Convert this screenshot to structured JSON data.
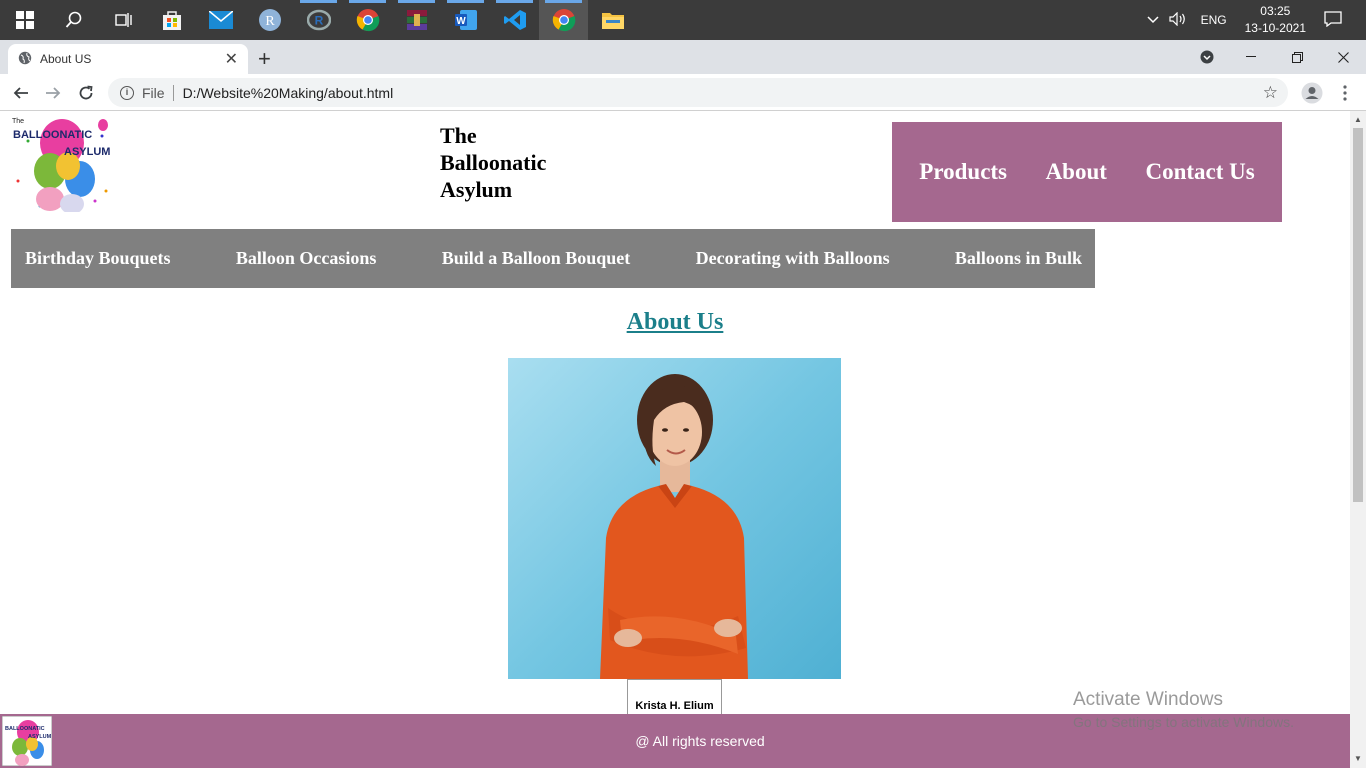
{
  "taskbar": {
    "apps": [
      "start-icon",
      "search-icon",
      "task-view-icon",
      "store-icon",
      "mail-icon",
      "r-app-icon",
      "rstudio-icon",
      "chrome-icon",
      "winrar-icon",
      "word-icon",
      "vscode-icon",
      "chrome-active-icon",
      "file-explorer-icon"
    ],
    "language": "ENG",
    "time": "03:25",
    "date": "13-10-2021"
  },
  "browser": {
    "tab_title": "About US",
    "address_label": "File",
    "url": "D:/Website%20Making/about.html"
  },
  "site": {
    "title_line1": "The",
    "title_line2": "Balloonatic",
    "title_line3": "Asylum",
    "logo_text_small": "The",
    "logo_text_main": "BALLOONATIC",
    "logo_text_sub": "ASYLUM",
    "top_nav": [
      "Products",
      "About",
      "Contact Us"
    ],
    "category_nav": [
      "Birthday Bouquets",
      "Balloon Occasions",
      "Build a Balloon Bouquet",
      "Decorating with Balloons",
      "Balloons in Bulk"
    ],
    "heading": "About Us",
    "person_name": "Krista H. Elium",
    "footer_text": "@ All rights reserved"
  },
  "watermark": {
    "line1": "Activate Windows",
    "line2": "Go to Settings to activate Windows."
  },
  "colors": {
    "nav_purple": "#a5688f",
    "cat_gray": "#808080",
    "heading_teal": "#1b7f8a"
  }
}
